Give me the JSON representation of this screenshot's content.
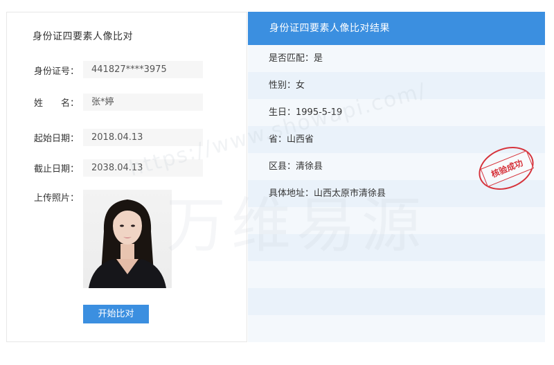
{
  "left_panel": {
    "title": "身份证四要素人像比对",
    "fields": [
      {
        "label": "身份证号：",
        "value": "441827****3975"
      },
      {
        "label": "姓　　名：",
        "value": "张*婷"
      },
      {
        "label": "起始日期：",
        "value": "2018.04.13"
      },
      {
        "label": "截止日期：",
        "value": "2038.04.13"
      }
    ],
    "photo_label": "上传照片：",
    "compare_button": "开始比对"
  },
  "right_panel": {
    "title": "身份证四要素人像比对结果",
    "results": [
      "是否匹配：是",
      "性别：女",
      "生日：1995-5-19",
      "省：山西省",
      "区县：清徐县",
      "具体地址：山西太原市清徐县",
      "",
      "",
      "",
      "",
      ""
    ],
    "stamp": "核验成功"
  },
  "watermark": {
    "url": "https://www.showapi.com/",
    "brand": "万维易源"
  },
  "colors": {
    "accent": "#3b8fe0",
    "stamp": "#d6333b",
    "row_alt": "#eaf2fa"
  }
}
